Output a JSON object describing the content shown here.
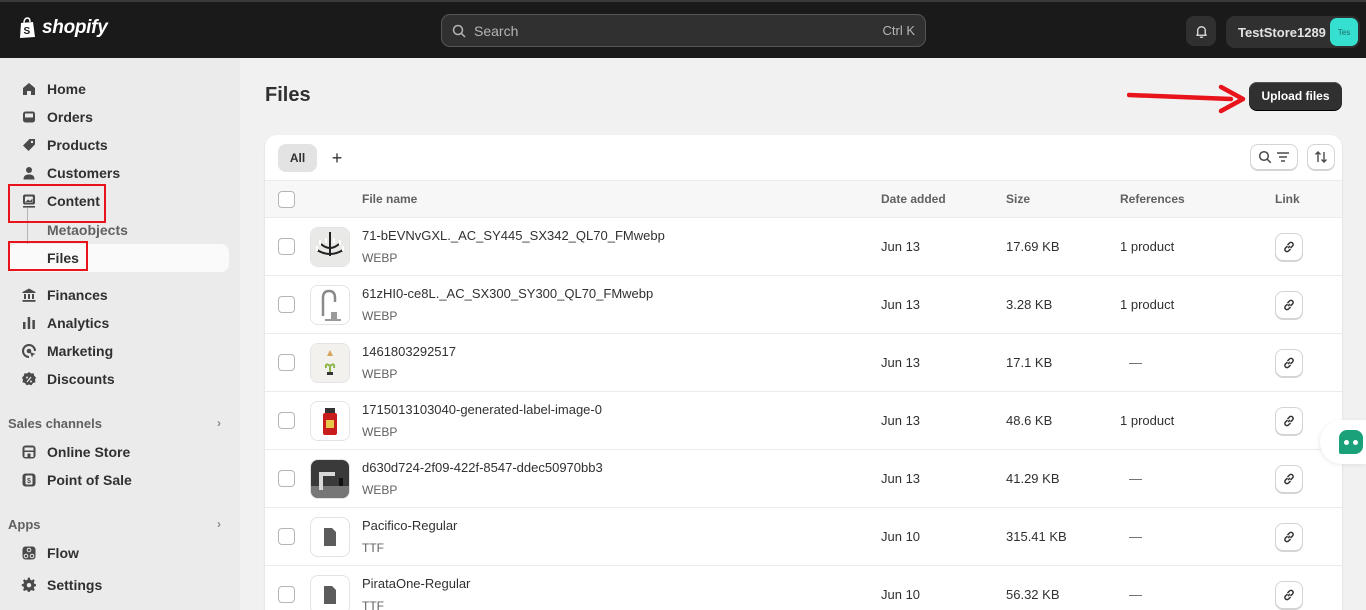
{
  "topbar": {
    "brand": "shopify",
    "search_placeholder": "Search",
    "search_shortcut": "Ctrl K",
    "store_name": "TestStore1289",
    "store_avatar": "Tes",
    "icons": {
      "bell": "bell-icon",
      "search": "search-icon",
      "logo": "shopify-bag-icon"
    }
  },
  "sidebar": {
    "items": [
      {
        "label": "Home",
        "icon": "home-icon"
      },
      {
        "label": "Orders",
        "icon": "inbox-icon"
      },
      {
        "label": "Products",
        "icon": "tag-icon"
      },
      {
        "label": "Customers",
        "icon": "person-icon"
      },
      {
        "label": "Content",
        "icon": "content-icon"
      },
      {
        "label": "Metaobjects",
        "sub": true
      },
      {
        "label": "Files",
        "sub": true,
        "active": true
      },
      {
        "label": "Finances",
        "icon": "bank-icon"
      },
      {
        "label": "Analytics",
        "icon": "bar-chart-icon"
      },
      {
        "label": "Marketing",
        "icon": "target-icon"
      },
      {
        "label": "Discounts",
        "icon": "discount-icon"
      }
    ],
    "sales_channels": {
      "label": "Sales channels",
      "items": [
        {
          "label": "Online Store",
          "icon": "store-icon"
        },
        {
          "label": "Point of Sale",
          "icon": "pos-icon"
        }
      ]
    },
    "apps": {
      "label": "Apps",
      "items": [
        {
          "label": "Flow",
          "icon": "flow-icon"
        }
      ]
    },
    "settings": {
      "label": "Settings",
      "icon": "gear-icon"
    }
  },
  "main": {
    "title": "Files",
    "upload_label": "Upload files",
    "tabs": [
      {
        "label": "All",
        "active": true
      }
    ],
    "add_tab": "+",
    "columns": [
      "File name",
      "Date added",
      "Size",
      "References",
      "Link"
    ],
    "files": [
      {
        "name": "71-bEVNvGXL._AC_SY445_SX342_QL70_FMwebp",
        "type": "WEBP",
        "date": "Jun 13",
        "size": "17.69 KB",
        "references": "1 product",
        "thumb": "chandelier"
      },
      {
        "name": "61zHI0-ce8L._AC_SX300_SY300_QL70_FMwebp",
        "type": "WEBP",
        "date": "Jun 13",
        "size": "3.28 KB",
        "references": "1 product",
        "thumb": "faucet"
      },
      {
        "name": "1461803292517",
        "type": "WEBP",
        "date": "Jun 13",
        "size": "17.1 KB",
        "references": "—",
        "thumb": "plant"
      },
      {
        "name": "1715013103040-generated-label-image-0",
        "type": "WEBP",
        "date": "Jun 13",
        "size": "48.6 KB",
        "references": "1 product",
        "thumb": "bottle"
      },
      {
        "name": "d630d724-2f09-422f-8547-ddec50970bb3",
        "type": "WEBP",
        "date": "Jun 13",
        "size": "41.29 KB",
        "references": "—",
        "thumb": "faucet-dark"
      },
      {
        "name": "Pacifico-Regular",
        "type": "TTF",
        "date": "Jun 10",
        "size": "315.41 KB",
        "references": "—",
        "thumb": "file"
      },
      {
        "name": "PirataOne-Regular",
        "type": "TTF",
        "date": "Jun 10",
        "size": "56.32 KB",
        "references": "—",
        "thumb": "file"
      }
    ]
  },
  "colors": {
    "topbar_bg": "#1a1a1a",
    "annotation_red": "#e8131b",
    "avatar_bg": "#36e0d1",
    "chat_green": "#1aa179"
  }
}
